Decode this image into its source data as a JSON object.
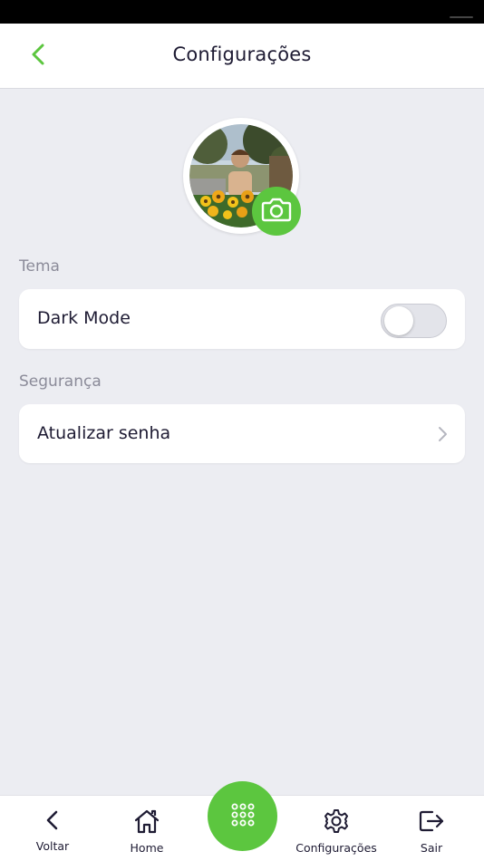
{
  "header": {
    "title": "Configurações"
  },
  "profile": {
    "avatar_alt": "Foto de perfil"
  },
  "sections": {
    "theme": {
      "label": "Tema",
      "dark_mode": {
        "label": "Dark Mode",
        "enabled": false
      }
    },
    "security": {
      "label": "Segurança",
      "update_password": {
        "label": "Atualizar senha"
      }
    }
  },
  "bottom_nav": {
    "items": [
      {
        "label": "Voltar",
        "icon": "chevron-left-icon"
      },
      {
        "label": "Home",
        "icon": "home-icon"
      },
      {
        "label": "Configurações",
        "icon": "gear-icon"
      },
      {
        "label": "Sair",
        "icon": "logout-icon"
      }
    ],
    "fab_icon": "grid-icon"
  },
  "colors": {
    "accent": "#5cc63f",
    "background": "#ecedf2",
    "text": "#1e1b33",
    "muted": "#8b8b99"
  }
}
